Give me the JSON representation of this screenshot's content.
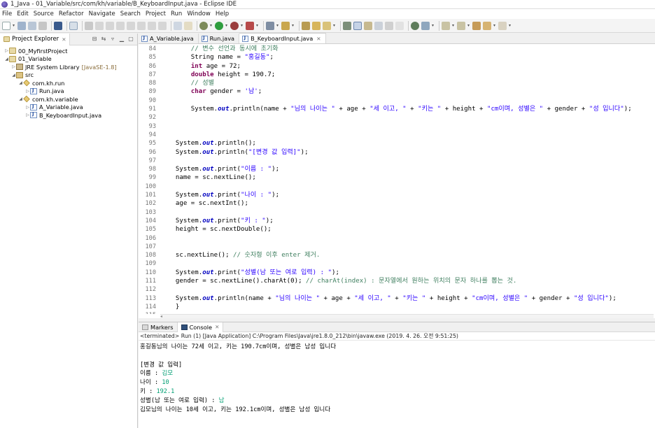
{
  "window": {
    "title": "1_Java - 01_Variable/src/com/kh/variable/B_KeyboardInput.java - Eclipse IDE"
  },
  "menu": [
    "File",
    "Edit",
    "Source",
    "Refactor",
    "Navigate",
    "Search",
    "Project",
    "Run",
    "Window",
    "Help"
  ],
  "explorer": {
    "tab_label": "Project Explorer",
    "tree": [
      {
        "twist": "▷",
        "icon": "project-icon",
        "label": "00_MyfirstProject",
        "suffix": ""
      },
      {
        "twist": "◢",
        "icon": "project-icon",
        "label": "01_Variable",
        "suffix": ""
      },
      {
        "twist": "▷",
        "icon": "library-icon",
        "label": "JRE System Library",
        "suffix": "[JavaSE-1.8]"
      },
      {
        "twist": "◢",
        "icon": "source-folder-icon",
        "label": "src",
        "suffix": ""
      },
      {
        "twist": "◢",
        "icon": "package-icon",
        "label": "com.kh.run",
        "suffix": ""
      },
      {
        "twist": "▷",
        "icon": "java-file-icon",
        "label": "Run.java",
        "suffix": ""
      },
      {
        "twist": "◢",
        "icon": "package-icon",
        "label": "com.kh.variable",
        "suffix": ""
      },
      {
        "twist": "▷",
        "icon": "java-file-icon",
        "label": "A_Variable.java",
        "suffix": ""
      },
      {
        "twist": "▷",
        "icon": "java-file-icon",
        "label": "B_KeyboardInput.java",
        "suffix": ""
      }
    ]
  },
  "editor": {
    "tabs": [
      {
        "label": "A_Variable.java",
        "active": false
      },
      {
        "label": "Run.java",
        "active": false
      },
      {
        "label": "B_KeyboardInput.java",
        "active": true
      }
    ],
    "lines": [
      {
        "n": "84",
        "parts": [
          [
            "cmt",
            "        // 변수 선언과 동시에 초기화"
          ]
        ]
      },
      {
        "n": "85",
        "parts": [
          [
            "",
            "        String name = "
          ],
          [
            "str",
            "\"홍길동\""
          ],
          [
            "",
            ";"
          ]
        ]
      },
      {
        "n": "86",
        "parts": [
          [
            "",
            "        "
          ],
          [
            "kw",
            "int"
          ],
          [
            "",
            " age = 72;"
          ]
        ]
      },
      {
        "n": "87",
        "parts": [
          [
            "",
            "        "
          ],
          [
            "kw",
            "double"
          ],
          [
            "",
            " height = 190.7;"
          ]
        ]
      },
      {
        "n": "88",
        "parts": [
          [
            "cmt",
            "        // 성별"
          ]
        ]
      },
      {
        "n": "89",
        "parts": [
          [
            "",
            "        "
          ],
          [
            "kw",
            "char"
          ],
          [
            "",
            " gender = "
          ],
          [
            "str",
            "'남'"
          ],
          [
            "",
            ";"
          ]
        ]
      },
      {
        "n": "90",
        "parts": [
          [
            "",
            ""
          ]
        ]
      },
      {
        "n": "91",
        "parts": [
          [
            "",
            "        System."
          ],
          [
            "fld",
            "out"
          ],
          [
            "",
            ".println(name + "
          ],
          [
            "str",
            "\"님의 나이는 \""
          ],
          [
            "",
            " + age + "
          ],
          [
            "str",
            "\"세 이고, \""
          ],
          [
            "",
            " + "
          ],
          [
            "str",
            "\"키는 \""
          ],
          [
            "",
            " + height + "
          ],
          [
            "str",
            "\"cm이며, 성별은 \""
          ],
          [
            "",
            " + gender + "
          ],
          [
            "str",
            "\"성 입니다\""
          ],
          [
            "",
            ");"
          ]
        ]
      },
      {
        "n": "92",
        "parts": [
          [
            "",
            ""
          ]
        ]
      },
      {
        "n": "93",
        "parts": [
          [
            "",
            ""
          ]
        ]
      },
      {
        "n": "94",
        "parts": [
          [
            "",
            ""
          ]
        ]
      },
      {
        "n": "95",
        "parts": [
          [
            "",
            "    System."
          ],
          [
            "fld",
            "out"
          ],
          [
            "",
            ".println();"
          ]
        ]
      },
      {
        "n": "96",
        "parts": [
          [
            "",
            "    System."
          ],
          [
            "fld",
            "out"
          ],
          [
            "",
            ".println("
          ],
          [
            "str",
            "\"[변경 값 입력]\""
          ],
          [
            "",
            ");"
          ]
        ]
      },
      {
        "n": "97",
        "parts": [
          [
            "",
            ""
          ]
        ]
      },
      {
        "n": "98",
        "parts": [
          [
            "",
            "    System."
          ],
          [
            "fld",
            "out"
          ],
          [
            "",
            ".print("
          ],
          [
            "str",
            "\"이름 : \""
          ],
          [
            "",
            ");"
          ]
        ]
      },
      {
        "n": "99",
        "parts": [
          [
            "",
            "    name = sc.nextLine();"
          ]
        ]
      },
      {
        "n": "100",
        "parts": [
          [
            "",
            ""
          ]
        ]
      },
      {
        "n": "101",
        "parts": [
          [
            "",
            "    System."
          ],
          [
            "fld",
            "out"
          ],
          [
            "",
            ".print("
          ],
          [
            "str",
            "\"나이 : \""
          ],
          [
            "",
            ");"
          ]
        ]
      },
      {
        "n": "102",
        "parts": [
          [
            "",
            "    age = sc.nextInt();"
          ]
        ]
      },
      {
        "n": "103",
        "parts": [
          [
            "",
            ""
          ]
        ]
      },
      {
        "n": "104",
        "parts": [
          [
            "",
            "    System."
          ],
          [
            "fld",
            "out"
          ],
          [
            "",
            ".print("
          ],
          [
            "str",
            "\"키 : \""
          ],
          [
            "",
            ");"
          ]
        ]
      },
      {
        "n": "105",
        "parts": [
          [
            "",
            "    height = sc.nextDouble();"
          ]
        ]
      },
      {
        "n": "106",
        "parts": [
          [
            "",
            ""
          ]
        ]
      },
      {
        "n": "107",
        "parts": [
          [
            "",
            ""
          ]
        ]
      },
      {
        "n": "108",
        "parts": [
          [
            "",
            "    sc.nextLine(); "
          ],
          [
            "cmt",
            "// 숫자형 이후 enter 제거."
          ]
        ]
      },
      {
        "n": "109",
        "parts": [
          [
            "",
            ""
          ]
        ]
      },
      {
        "n": "110",
        "parts": [
          [
            "",
            "    System."
          ],
          [
            "fld",
            "out"
          ],
          [
            "",
            ".print("
          ],
          [
            "str",
            "\"성별(남 또는 여로 입력) : \""
          ],
          [
            "",
            ");"
          ]
        ]
      },
      {
        "n": "111",
        "parts": [
          [
            "",
            "    gender = sc.nextLine().charAt(0); "
          ],
          [
            "cmt",
            "// charAt(index) : 문자열에서 원하는 위치의 문자 하나를 뽑는 것."
          ]
        ]
      },
      {
        "n": "112",
        "parts": [
          [
            "",
            ""
          ]
        ]
      },
      {
        "n": "113",
        "parts": [
          [
            "",
            "    System."
          ],
          [
            "fld",
            "out"
          ],
          [
            "",
            ".println(name + "
          ],
          [
            "str",
            "\"님의 나이는 \""
          ],
          [
            "",
            " + age + "
          ],
          [
            "str",
            "\"세 이고, \""
          ],
          [
            "",
            " + "
          ],
          [
            "str",
            "\"키는 \""
          ],
          [
            "",
            " + height + "
          ],
          [
            "str",
            "\"cm이며, 성별은 \""
          ],
          [
            "",
            " + gender + "
          ],
          [
            "str",
            "\"성 입니다\""
          ],
          [
            "",
            ");"
          ]
        ]
      },
      {
        "n": "114",
        "parts": [
          [
            "",
            "    }"
          ]
        ]
      },
      {
        "n": "115",
        "parts": [
          [
            "",
            ""
          ]
        ]
      }
    ]
  },
  "console": {
    "tabs": [
      {
        "label": "Markers",
        "active": false
      },
      {
        "label": "Console",
        "active": true
      }
    ],
    "header": "<terminated> Run (1) [Java Application] C:\\Program Files\\Java\\jre1.8.0_212\\bin\\javaw.exe (2019. 4. 26. 오전 9:51:25)",
    "lines": [
      [
        [
          "",
          "홍길동님의 나이는 72세 이고, 키는 190.7cm이며, 성별은 남성 입니다"
        ]
      ],
      [
        [
          "",
          ""
        ]
      ],
      [
        [
          "",
          "[변경 값 입력]"
        ]
      ],
      [
        [
          "",
          "이름 : "
        ],
        [
          "in",
          "김모"
        ]
      ],
      [
        [
          "",
          "나이 : "
        ],
        [
          "in",
          "10"
        ]
      ],
      [
        [
          "",
          "키 : "
        ],
        [
          "in",
          "192.1"
        ]
      ],
      [
        [
          "",
          "성별(남 또는 여로 입력) : "
        ],
        [
          "in",
          "남"
        ]
      ],
      [
        [
          "",
          "김모님의 나이는 10세 이고, 키는 192.1cm이며, 성별은 남성 입니다"
        ]
      ]
    ]
  },
  "colors": {
    "keyword": "#7f0055",
    "string": "#2a00ff",
    "comment": "#3f7f5f",
    "field": "#0000c0",
    "console_input": "#009f73"
  }
}
